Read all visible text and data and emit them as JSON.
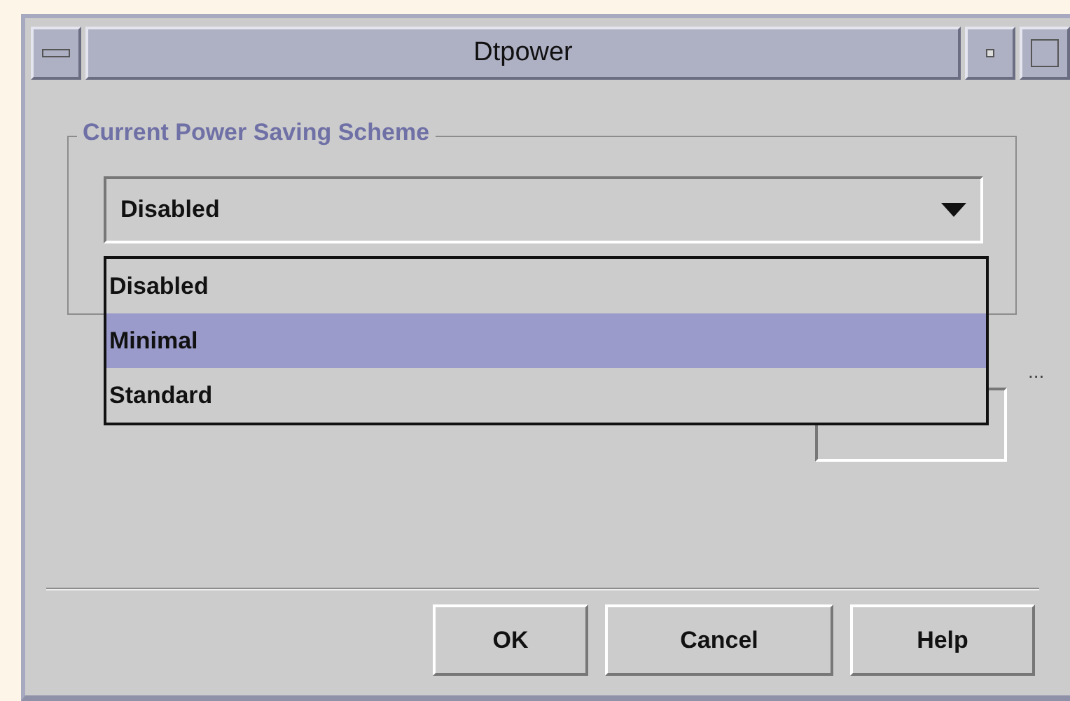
{
  "window": {
    "title": "Dtpower"
  },
  "group": {
    "title": "Current Power Saving Scheme",
    "combo": {
      "value": "Disabled",
      "expanded": true,
      "options": [
        {
          "label": "Disabled",
          "highlighted": false
        },
        {
          "label": "Minimal",
          "highlighted": true
        },
        {
          "label": "Standard",
          "highlighted": false
        }
      ]
    }
  },
  "ellipsis": "...",
  "buttons": [
    "OK",
    "Cancel",
    "Help"
  ]
}
